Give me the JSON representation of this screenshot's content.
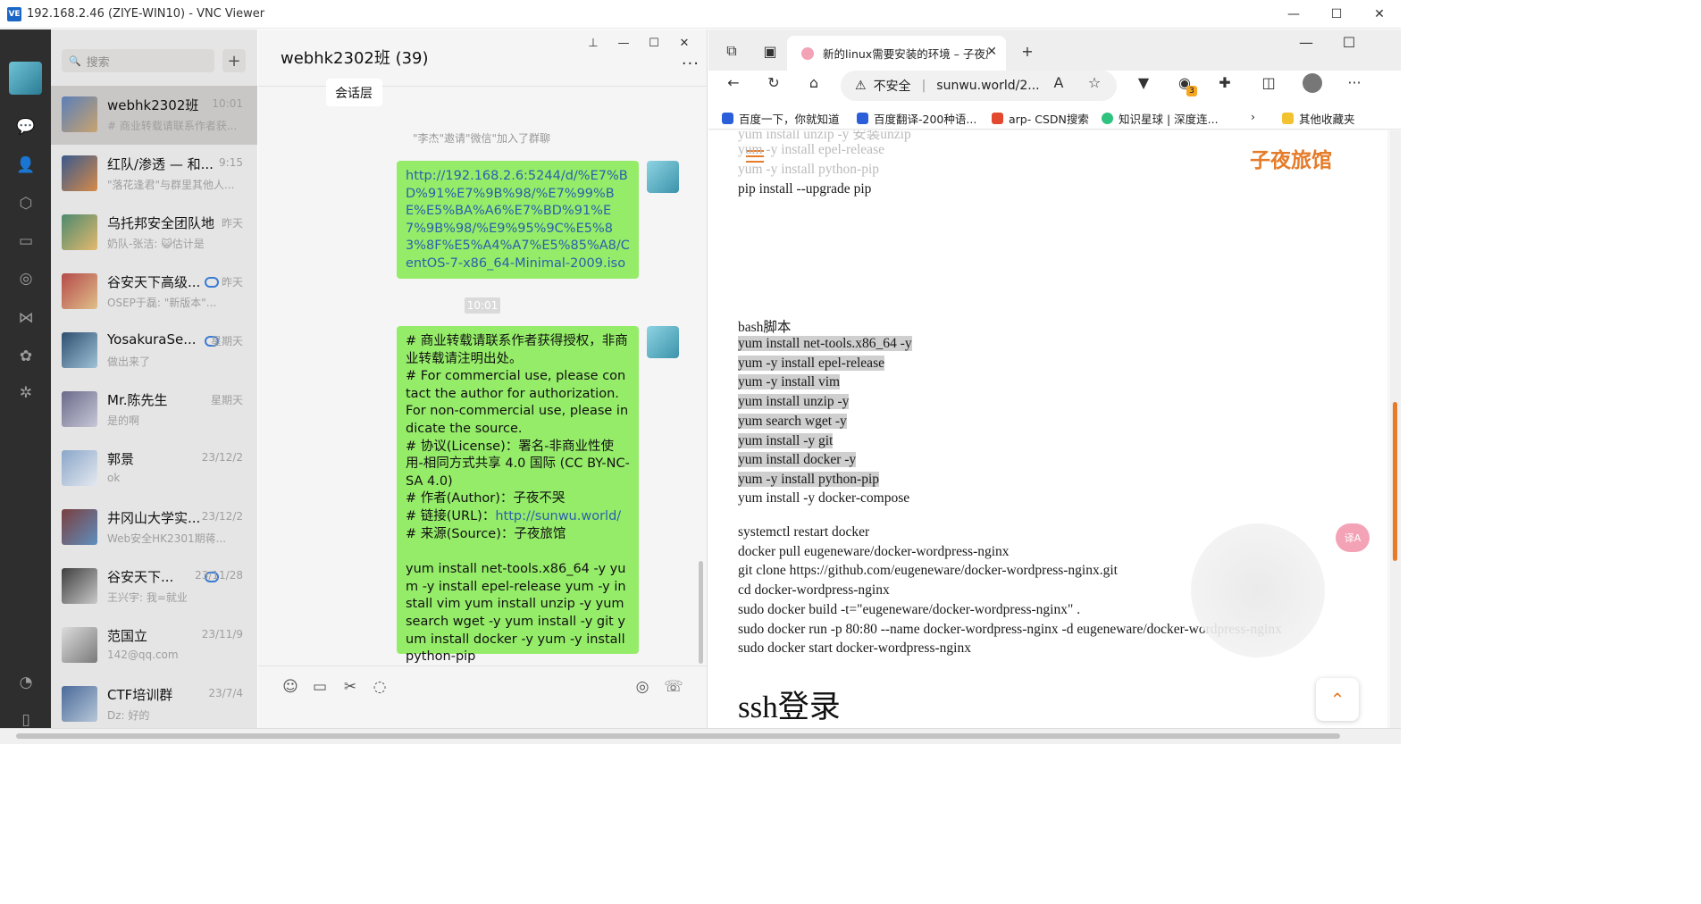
{
  "window": {
    "title": "192.168.2.46 (ZIYE-WIN10) - VNC Viewer",
    "logo_text": "VE"
  },
  "wechat": {
    "search_placeholder": "搜索",
    "chats": [
      {
        "name": "webhk2302班",
        "time": "10:01",
        "preview": "# 商业转载请联系作者获...",
        "selected": true
      },
      {
        "name": "红队/渗透 — 和...",
        "time": "9:15",
        "preview": "\"落花逢君\"与群里其他人..."
      },
      {
        "name": "乌托邦安全团队地...",
        "time": "昨天",
        "preview": "奶队-张洁: 😺估计是"
      },
      {
        "name": "谷安天下高级...",
        "time": "昨天",
        "preview": "OSEP于磊: \"新版本\"..."
      },
      {
        "name": "YosakuraSe...",
        "time": "星期天",
        "preview": "做出来了"
      },
      {
        "name": "Mr.陈先生",
        "time": "星期天",
        "preview": "是的啊"
      },
      {
        "name": "郭景",
        "time": "23/12/2",
        "preview": "ok"
      },
      {
        "name": "井冈山大学实...",
        "time": "23/12/2",
        "preview": "Web安全HK2301期蒋..."
      },
      {
        "name": "谷安天下...",
        "time": "23/11/28",
        "preview": "王兴宇: 我=就业"
      },
      {
        "name": "范国立",
        "time": "23/11/9",
        "preview": "142@qq.com"
      },
      {
        "name": "CTF培训群",
        "time": "23/7/4",
        "preview": "Dz: 好的"
      }
    ],
    "chat": {
      "title": "webhk2302班 (39)",
      "prev_bubble": "会话层",
      "system_msg": "\"李杰\"邀请\"微信\"加入了群聊",
      "time_tag": "10:01",
      "msg1": "http://192.168.2.6:5244/d/%E7%BD%91%E7%9B%98/%E7%99%BE%E5%BA%A6%E7%BD%91%E7%9B%98/%E9%95%9C%E5%83%8F%E5%A4%A7%E5%85%A8/CentOS-7-x86_64-Minimal-2009.iso",
      "msg2_lines": [
        "# 商业转载请联系作者获得授权，非商业转载请注明出处。",
        "# For commercial use, please contact the author for authorization. For non-commercial use, please indicate the source.",
        "# 协议(License)：署名-非商业性使用-相同方式共享 4.0 国际 (CC BY-NC-SA 4.0)",
        "# 作者(Author)：子夜不哭"
      ],
      "msg2_link_prefix": "# 链接(URL)：",
      "msg2_link": "http://sunwu.world/",
      "msg2_source": "# 来源(Source)：子夜旅馆",
      "msg2_cmds": "yum install net-tools.x86_64 -y yum -y install epel-release yum -y install vim yum install unzip -y yum search wget -y yum install -y git yum install docker -y yum -y install python-pip"
    }
  },
  "browser": {
    "tab_title": "新的linux需要安装的环境 – 子夜旅馆",
    "address": {
      "security": "不安全",
      "url": "sunwu.world/2..."
    },
    "favorites": [
      {
        "label": "百度一下，你就知道",
        "color": "#2b5fd9"
      },
      {
        "label": "百度翻译-200种语...",
        "color": "#2b5fd9"
      },
      {
        "label": "arp- CSDN搜索",
        "color": "#e2492f"
      },
      {
        "label": "知识星球 | 深度连...",
        "color": "#2ec27e"
      }
    ],
    "favorites_other": "其他收藏夹",
    "ext_badge": "3",
    "site_brand": "子夜旅馆",
    "faded_lines": [
      "yum install unzip -y 安装unzip",
      "yum -y install epel-release",
      "yum -y install python-pip"
    ],
    "line_pip": "pip install --upgrade pip",
    "script_label": "bash脚本",
    "script_lines": [
      "yum install net-tools.x86_64 -y",
      "yum -y install epel-release",
      "yum -y install vim",
      "yum install unzip -y",
      "yum search wget -y",
      "yum install -y git",
      "yum install docker -y",
      "yum -y install python-pip"
    ],
    "line_compose": "yum install -y docker-compose",
    "docker_lines": [
      "systemctl restart docker",
      "docker pull eugeneware/docker-wordpress-nginx",
      "git clone https://github.com/eugeneware/docker-wordpress-nginx.git",
      "cd docker-wordpress-nginx",
      "sudo docker build -t=\"eugeneware/docker-wordpress-nginx\" .",
      "sudo docker run -p 80:80 --name docker-wordpress-nginx -d eugeneware/docker-wordpress-nginx",
      "sudo docker start docker-wordpress-nginx"
    ],
    "section_heading": "ssh登录",
    "translate_label": "译A"
  }
}
